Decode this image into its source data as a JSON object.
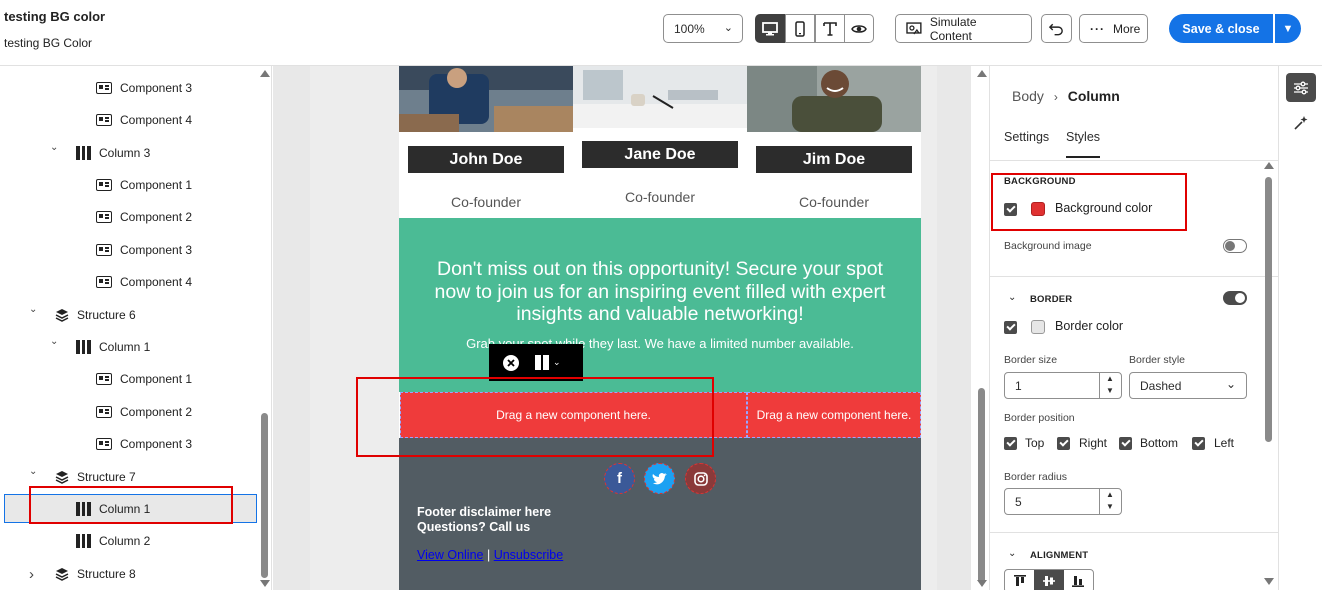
{
  "header": {
    "title": "testing BG color",
    "subtitle": "testing BG Color",
    "zoom": "100%",
    "simulate_label": "Simulate Content",
    "more_label": "More",
    "save_label": "Save & close"
  },
  "tree": {
    "items": [
      {
        "label": "Component 3",
        "type": "component"
      },
      {
        "label": "Component 4",
        "type": "component"
      },
      {
        "label": "Column 3",
        "type": "column"
      },
      {
        "label": "Component 1",
        "type": "component"
      },
      {
        "label": "Component 2",
        "type": "component"
      },
      {
        "label": "Component 3",
        "type": "component"
      },
      {
        "label": "Component 4",
        "type": "component"
      },
      {
        "label": "Structure 6",
        "type": "structure"
      },
      {
        "label": "Column 1",
        "type": "column"
      },
      {
        "label": "Component 1",
        "type": "component"
      },
      {
        "label": "Component 2",
        "type": "component"
      },
      {
        "label": "Component 3",
        "type": "component"
      },
      {
        "label": "Structure 7",
        "type": "structure"
      },
      {
        "label": "Column 1",
        "type": "column",
        "selected": true
      },
      {
        "label": "Column 2",
        "type": "column"
      },
      {
        "label": "Structure 8",
        "type": "structure"
      }
    ]
  },
  "email": {
    "people": [
      {
        "name": "John Doe",
        "role": "Co-founder"
      },
      {
        "name": "Jane Doe",
        "role": "Co-founder"
      },
      {
        "name": "Jim Doe",
        "role": "Co-founder"
      }
    ],
    "promo": "Don't miss out on this opportunity! Secure your spot now to join us for an inspiring event filled with expert insights and valuable networking!",
    "grab": "Grab your spot while they last. We have a limited number available.",
    "drop_text": "Drag a new component here.",
    "footer_disclaimer": "Footer disclaimer here",
    "footer_call": "Questions? Call us",
    "view_online": "View Online",
    "separator": "|",
    "unsubscribe": "Unsubscribe"
  },
  "panel": {
    "crumb_parent": "Body",
    "crumb_current": "Column",
    "tab_settings": "Settings",
    "tab_styles": "Styles",
    "background_heading": "BACKGROUND",
    "background_color_label": "Background color",
    "background_color_value": "#e03131",
    "background_image_label": "Background image",
    "border_heading": "BORDER",
    "border_color_label": "Border color",
    "border_size_label": "Border size",
    "border_size_value": "1",
    "border_style_label": "Border style",
    "border_style_value": "Dashed",
    "border_position_label": "Border position",
    "pos_top": "Top",
    "pos_right": "Right",
    "pos_bottom": "Bottom",
    "pos_left": "Left",
    "border_radius_label": "Border radius",
    "border_radius_value": "5",
    "alignment_heading": "ALIGNMENT"
  },
  "colors": {
    "accent": "#1473e6",
    "green_section": "#4bbb95",
    "drop_zone": "#ef3b3b",
    "footer": "#525c63",
    "highlight": "#e00000"
  }
}
